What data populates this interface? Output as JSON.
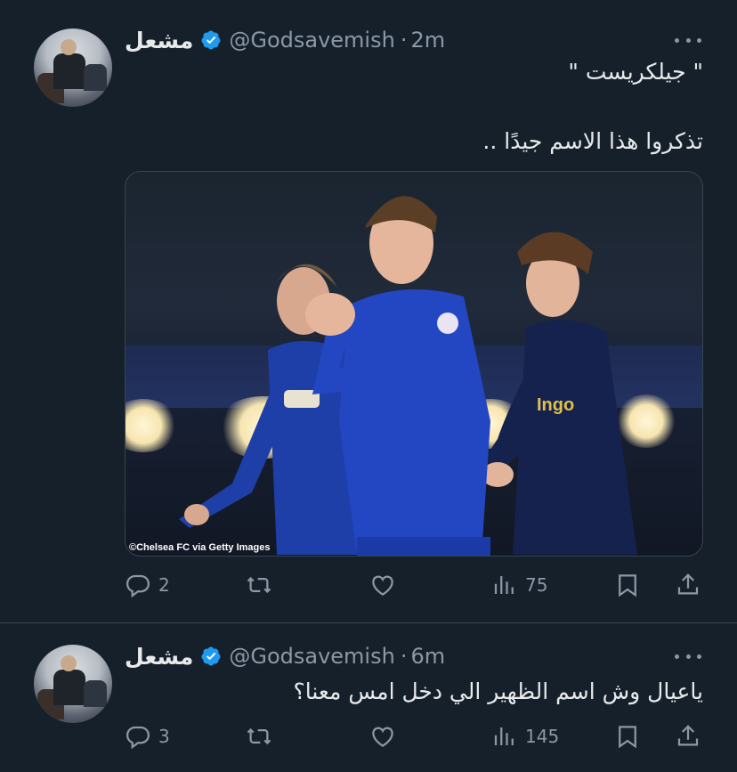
{
  "tweets": [
    {
      "author": "مشعل",
      "handle": "@Godsavemish",
      "time": "2m",
      "lines": [
        "\" جيلكريست \"",
        "تذكروا هذا الاسم جيدًا .."
      ],
      "media_credit": "©Chelsea FC via Getty Images",
      "replies": "2",
      "retweets": "",
      "likes": "",
      "views": "75"
    },
    {
      "author": "مشعل",
      "handle": "@Godsavemish",
      "time": "6m",
      "lines": [
        "ياعيال وش اسم الظهير الي دخل امس معنا؟"
      ],
      "replies": "3",
      "retweets": "",
      "likes": "",
      "views": "145"
    }
  ],
  "colors": {
    "background": "#15202b",
    "verified": "#1d9bf0",
    "muted": "#8b98a5",
    "text": "#e7e9ea"
  },
  "icons": [
    "more-icon",
    "verified-icon",
    "reply-icon",
    "retweet-icon",
    "like-icon",
    "views-icon",
    "bookmark-icon",
    "share-icon"
  ]
}
